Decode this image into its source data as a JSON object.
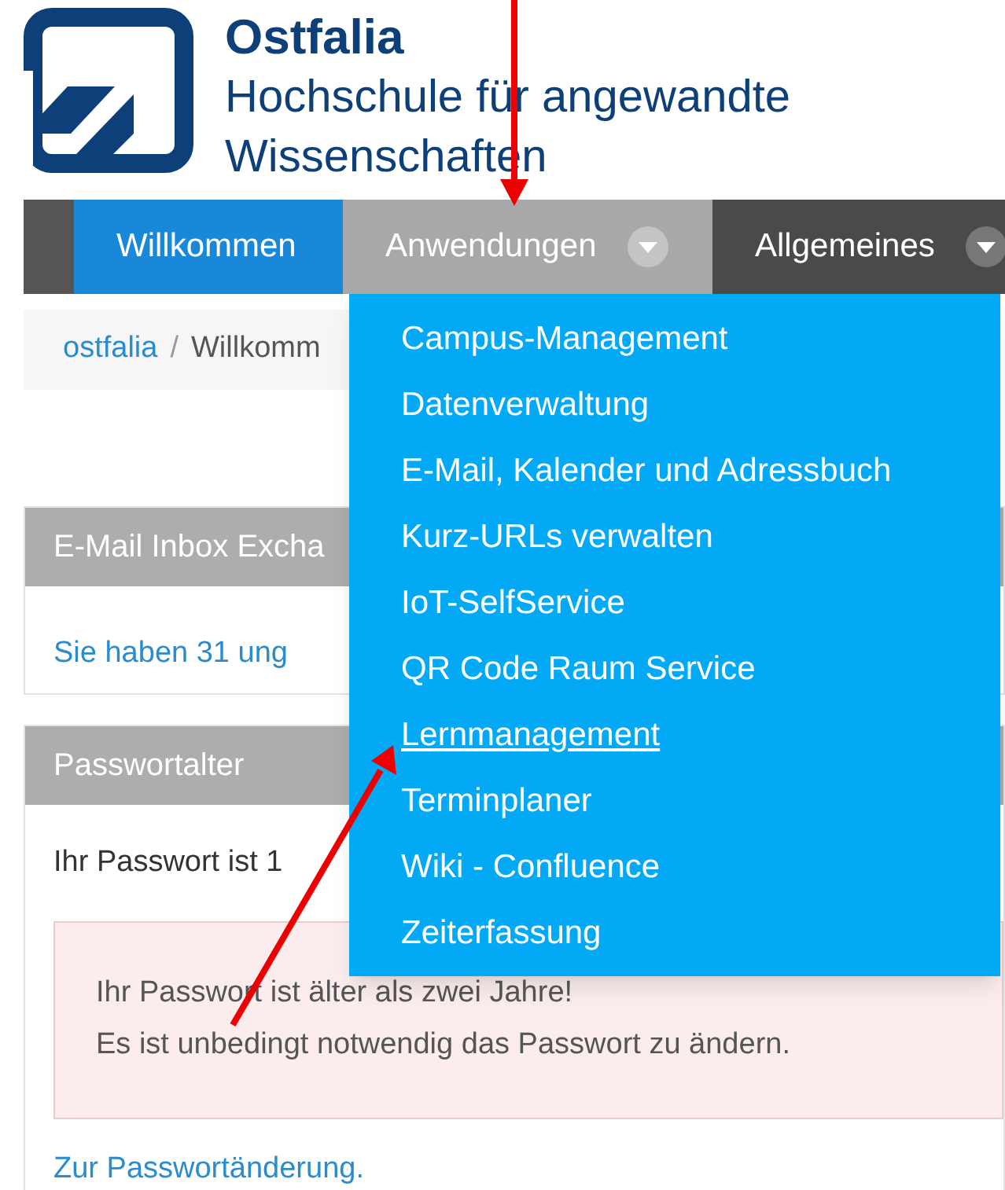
{
  "header": {
    "name": "Ostfalia",
    "subtitle_lines": [
      "Hochschule für angewandte",
      "Wissenschaften"
    ]
  },
  "nav": [
    {
      "label": "Willkommen",
      "selected": true,
      "has_dropdown": false
    },
    {
      "label": "Anwendungen",
      "selected": false,
      "has_dropdown": true,
      "open": true
    },
    {
      "label": "Allgemeines",
      "selected": false,
      "has_dropdown": true,
      "open": false
    }
  ],
  "breadcrumb": [
    {
      "label": "ostfalia",
      "link": true
    },
    {
      "label": "Willkomm",
      "link": false
    }
  ],
  "breadcrumb_separator": "/",
  "dropdown": [
    {
      "label": "Campus-Management",
      "hovered": false
    },
    {
      "label": "Datenverwaltung",
      "hovered": false
    },
    {
      "label": "E-Mail, Kalender und Adressbuch",
      "hovered": false
    },
    {
      "label": "Kurz-URLs verwalten",
      "hovered": false
    },
    {
      "label": "IoT-SelfService",
      "hovered": false
    },
    {
      "label": "QR Code Raum Service",
      "hovered": false
    },
    {
      "label": "Lernmanagement",
      "hovered": true
    },
    {
      "label": "Terminplaner",
      "hovered": false
    },
    {
      "label": "Wiki - Confluence",
      "hovered": false
    },
    {
      "label": "Zeiterfassung",
      "hovered": false
    }
  ],
  "panels": [
    {
      "title": "E-Mail Inbox Excha",
      "body": [
        {
          "kind": "link",
          "text": "Sie haben 31 ung"
        }
      ]
    },
    {
      "title": "Passwortalter",
      "body": [
        {
          "kind": "text",
          "text": "Ihr Passwort ist 1"
        },
        {
          "kind": "alert",
          "lines": [
            "Ihr Passwort ist älter als zwei Jahre!",
            "Es ist unbedingt notwendig das Passwort zu ändern."
          ]
        },
        {
          "kind": "link",
          "text": "Zur Passwortänderung."
        }
      ]
    }
  ]
}
